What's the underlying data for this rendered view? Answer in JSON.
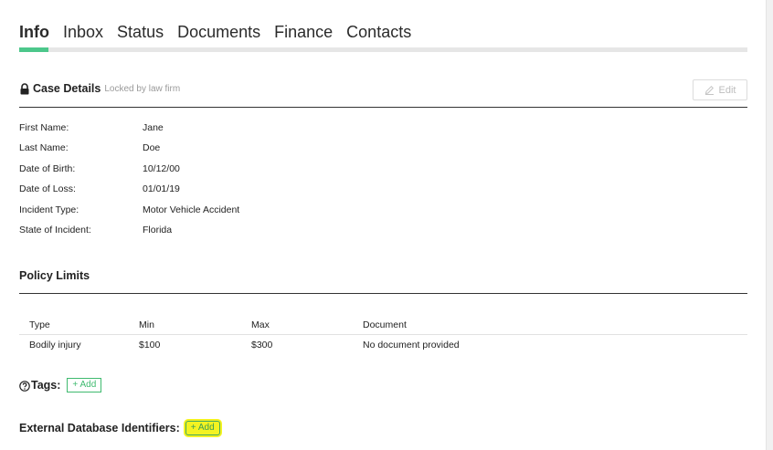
{
  "tabs": [
    {
      "label": "Info",
      "active": true
    },
    {
      "label": "Inbox",
      "active": false
    },
    {
      "label": "Status",
      "active": false
    },
    {
      "label": "Documents",
      "active": false
    },
    {
      "label": "Finance",
      "active": false
    },
    {
      "label": "Contacts",
      "active": false
    }
  ],
  "case_details": {
    "title": "Case Details",
    "subtitle": "Locked by law firm",
    "edit_label": "Edit",
    "fields": [
      {
        "label": "First Name",
        "value": "Jane"
      },
      {
        "label": "Last Name",
        "value": "Doe"
      },
      {
        "label": "Date of Birth",
        "value": "10/12/00"
      },
      {
        "label": "Date of Loss",
        "value": "01/01/19"
      },
      {
        "label": "Incident Type",
        "value": "Motor Vehicle Accident"
      },
      {
        "label": "State of Incident",
        "value": "Florida"
      }
    ]
  },
  "policy_limits": {
    "title": "Policy Limits",
    "columns": [
      "Type",
      "Min",
      "Max",
      "Document"
    ],
    "rows": [
      [
        "Bodily injury",
        "$100",
        "$300",
        "No document provided"
      ]
    ]
  },
  "tags": {
    "label": "Tags:",
    "add_label": "+ Add"
  },
  "external_ids": {
    "label": "External Database Identifiers:",
    "add_label": "+ Add"
  },
  "colors": {
    "accent": "#4cc78b",
    "add_green": "#3fba6f",
    "highlight": "#f3f321"
  },
  "icons": {
    "lock": "lock-icon",
    "pencil": "pencil-icon",
    "help": "help-circle-icon"
  }
}
